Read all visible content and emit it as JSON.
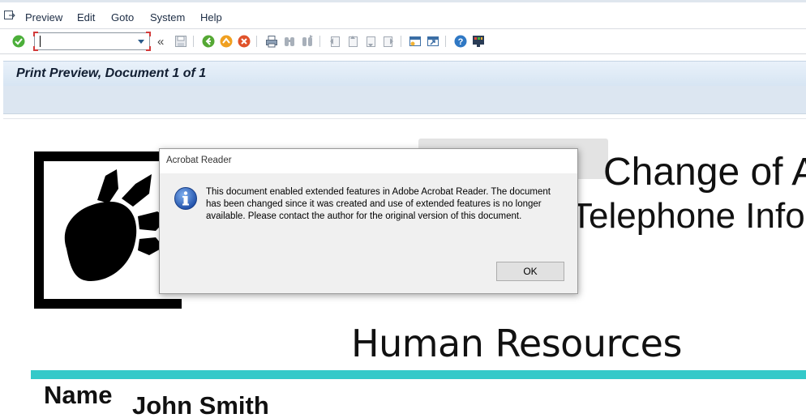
{
  "menu": {
    "items": [
      "Preview",
      "Edit",
      "Goto",
      "System",
      "Help"
    ]
  },
  "toolbar": {
    "command_field_value": "",
    "icons": [
      "check-icon",
      "command-field",
      "back-double-arrow",
      "save-icon",
      "back-icon",
      "exit-icon",
      "cancel-icon",
      "print-icon",
      "find-icon",
      "find-next-icon",
      "first-page-icon",
      "previous-page-icon",
      "next-page-icon",
      "last-page-icon",
      "create-session-icon",
      "shortcut-icon",
      "help-icon",
      "layout-icon"
    ],
    "double_arrow_label": "«"
  },
  "window": {
    "title": "Print Preview, Document 1 of 1"
  },
  "document": {
    "title_line1": "Change of A",
    "title_line2": "Telephone Info",
    "department": "Human Resources",
    "name_label": "Name",
    "name_value": "John Smith",
    "accent_color": "#34c9c9"
  },
  "dialog": {
    "title": "Acrobat Reader",
    "message": "This document enabled extended features in Adobe Acrobat Reader. The document has been changed since it was created and use of extended features is no longer available. Please contact the author for the original version of this document.",
    "ok_label": "OK"
  }
}
